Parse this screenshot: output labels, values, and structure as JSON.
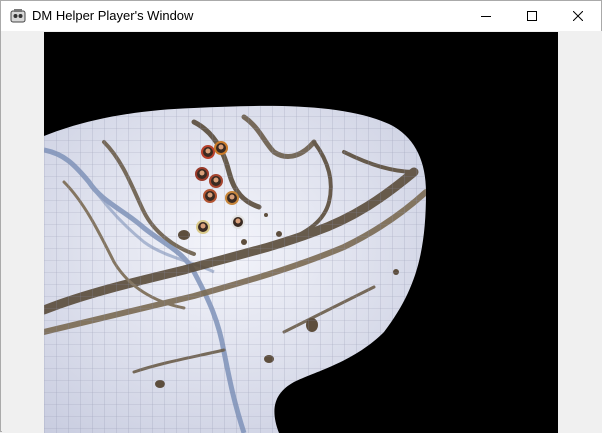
{
  "window": {
    "title": "DM Helper Player's Window",
    "app_icon": "dm-helper-app-icon",
    "controls": {
      "minimize_icon": "minimize-icon",
      "maximize_icon": "maximize-icon",
      "close_icon": "close-icon"
    }
  },
  "map": {
    "terrain": "snowy mountain pass battle map",
    "grid": true,
    "fog_of_war": true,
    "colors": {
      "snow": "#e4e6f2",
      "rock": "#6b5d4a",
      "water": "#7e92b8",
      "fog": "#000000",
      "grid": "#8a8fa8"
    },
    "tokens": [
      {
        "name": "token-1"
      },
      {
        "name": "token-2"
      },
      {
        "name": "token-3"
      },
      {
        "name": "token-4"
      },
      {
        "name": "token-5"
      },
      {
        "name": "token-6"
      },
      {
        "name": "token-7"
      },
      {
        "name": "token-8"
      }
    ]
  }
}
